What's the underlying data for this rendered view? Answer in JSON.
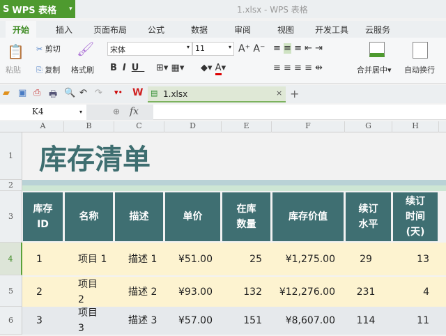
{
  "app": {
    "name": "WPS 表格",
    "window_title": "1.xlsx - WPS 表格"
  },
  "tabs": [
    "开始",
    "插入",
    "页面布局",
    "公式",
    "数据",
    "审阅",
    "视图",
    "开发工具",
    "云服务"
  ],
  "ribbon": {
    "paste": "粘贴",
    "cut": "剪切",
    "copy": "复制",
    "format_painter": "格式刷",
    "font": "宋体",
    "size": "11",
    "merge": "合并居中",
    "wrap": "自动换行"
  },
  "file_tab": "1.xlsx",
  "name_box": "K4",
  "fx": "fx",
  "columns": [
    "A",
    "B",
    "C",
    "D",
    "E",
    "F",
    "G",
    "H"
  ],
  "rows": [
    "1",
    "2",
    "3",
    "4",
    "5",
    "6"
  ],
  "sheet": {
    "title": "库存清单",
    "headers": [
      "库存\nID",
      "名称",
      "描述",
      "单价",
      "在库\n数量",
      "库存价值",
      "续订\n水平",
      "续订\n时间\n(天)"
    ],
    "data": [
      [
        "1",
        "项目 1",
        "描述 1",
        "¥51.00",
        "25",
        "¥1,275.00",
        "29",
        "13"
      ],
      [
        "2",
        "项目\n2",
        "描述 2",
        "¥93.00",
        "132",
        "¥12,276.00",
        "231",
        "4"
      ],
      [
        "3",
        "项目\n3",
        "描述 3",
        "¥57.00",
        "151",
        "¥8,607.00",
        "114",
        "11"
      ]
    ]
  },
  "colors": {
    "accent": "#4e9a2f",
    "header": "#3f6f72"
  }
}
